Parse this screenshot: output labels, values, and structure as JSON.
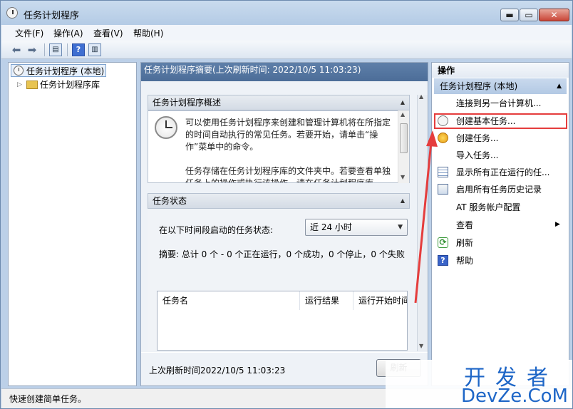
{
  "window": {
    "title": "任务计划程序",
    "controls": {
      "minimize": "▬",
      "maximize": "▭",
      "close": "✕"
    }
  },
  "menubar": {
    "items": [
      "文件(F)",
      "操作(A)",
      "查看(V)",
      "帮助(H)"
    ]
  },
  "toolbar": {
    "back_icon": "arrow-left-icon",
    "forward_icon": "arrow-right-icon",
    "help_glyph": "?"
  },
  "tree": {
    "root_label": "任务计划程序 (本地)",
    "child_label": "任务计划程序库"
  },
  "center": {
    "header": "任务计划程序摘要(上次刷新时间: 2022/10/5 11:03:23)",
    "overview": {
      "title": "任务计划程序概述",
      "text1": "可以使用任务计划程序来创建和管理计算机将在所指定的时间自动执行的常见任务。若要开始，请单击“操作”菜单中的命令。",
      "text2": "任务存储在任务计划程序库的文件夹中。若要查看单独任务上的操作或执行该操作，请在任务计划程序库"
    },
    "status": {
      "title": "任务状态",
      "period_label": "在以下时间段启动的任务状态:",
      "period_value": "近 24 小时",
      "summary": "摘要: 总计 0 个 - 0 个正在运行，0 个成功，0 个停止，0 个失败",
      "columns": [
        "任务名",
        "运行结果",
        "运行开始时间"
      ]
    },
    "footer": {
      "last_refresh": "上次刷新时间2022/10/5 11:03:23",
      "refresh_button": "刷新"
    }
  },
  "actions": {
    "title": "操作",
    "group": "任务计划程序 (本地)",
    "items": [
      {
        "label": "连接到另一台计算机...",
        "icon": ""
      },
      {
        "label": "创建基本任务...",
        "icon": "basic-task-icon"
      },
      {
        "label": "创建任务...",
        "icon": "create-task-icon"
      },
      {
        "label": "导入任务...",
        "icon": ""
      },
      {
        "label": "显示所有正在运行的任...",
        "icon": "list-icon"
      },
      {
        "label": "启用所有任务历史记录",
        "icon": "history-icon"
      },
      {
        "label": "AT 服务帐户配置",
        "icon": ""
      },
      {
        "label": "查看",
        "icon": ""
      },
      {
        "label": "刷新",
        "icon": "refresh-icon"
      },
      {
        "label": "帮助",
        "icon": "help-icon"
      }
    ],
    "refresh_glyph": "⟳",
    "help_glyph": "?"
  },
  "statusbar": {
    "text": "快速创建简单任务。"
  },
  "watermark": {
    "top": "开发者",
    "bottom": "DevZe.CoM"
  },
  "colors": {
    "highlight": "#e53d3d",
    "header_blue": "#4c6d98",
    "watermark": "#1e66c7"
  }
}
